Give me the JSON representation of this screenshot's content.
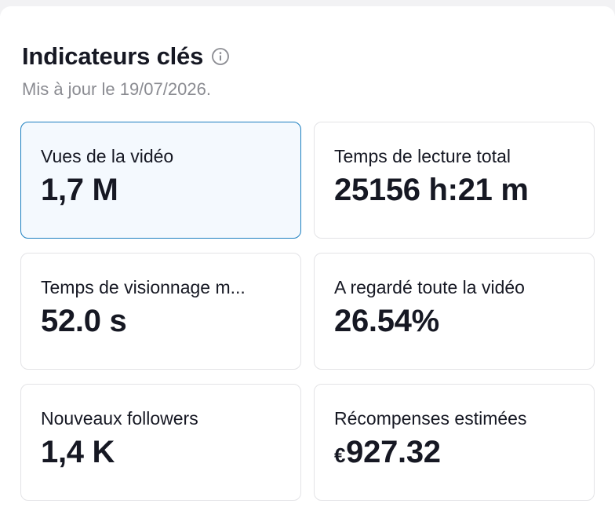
{
  "header": {
    "title": "Indicateurs clés",
    "subtitle": "Mis à jour le 19/07/2026.",
    "info_icon": "info-circle-icon"
  },
  "metrics": [
    {
      "label": "Vues de la vidéo",
      "value": "1,7 M",
      "selected": true
    },
    {
      "label": "Temps de lecture total",
      "value": "25156 h:21 m",
      "selected": false
    },
    {
      "label": "Temps de visionnage m...",
      "value": "52.0 s",
      "selected": false
    },
    {
      "label": "A regardé toute la vidéo",
      "value": "26.54%",
      "selected": false
    },
    {
      "label": "Nouveaux followers",
      "value": "1,4 K",
      "selected": false
    },
    {
      "label": "Récompenses estimées",
      "currency": "€",
      "value": "927.32",
      "selected": false
    }
  ],
  "colors": {
    "text_primary": "#161823",
    "text_secondary": "#8a8b91",
    "card_border": "#e3e3e6",
    "selected_border": "#1c7fc0",
    "selected_background": "#f4f9fe"
  }
}
